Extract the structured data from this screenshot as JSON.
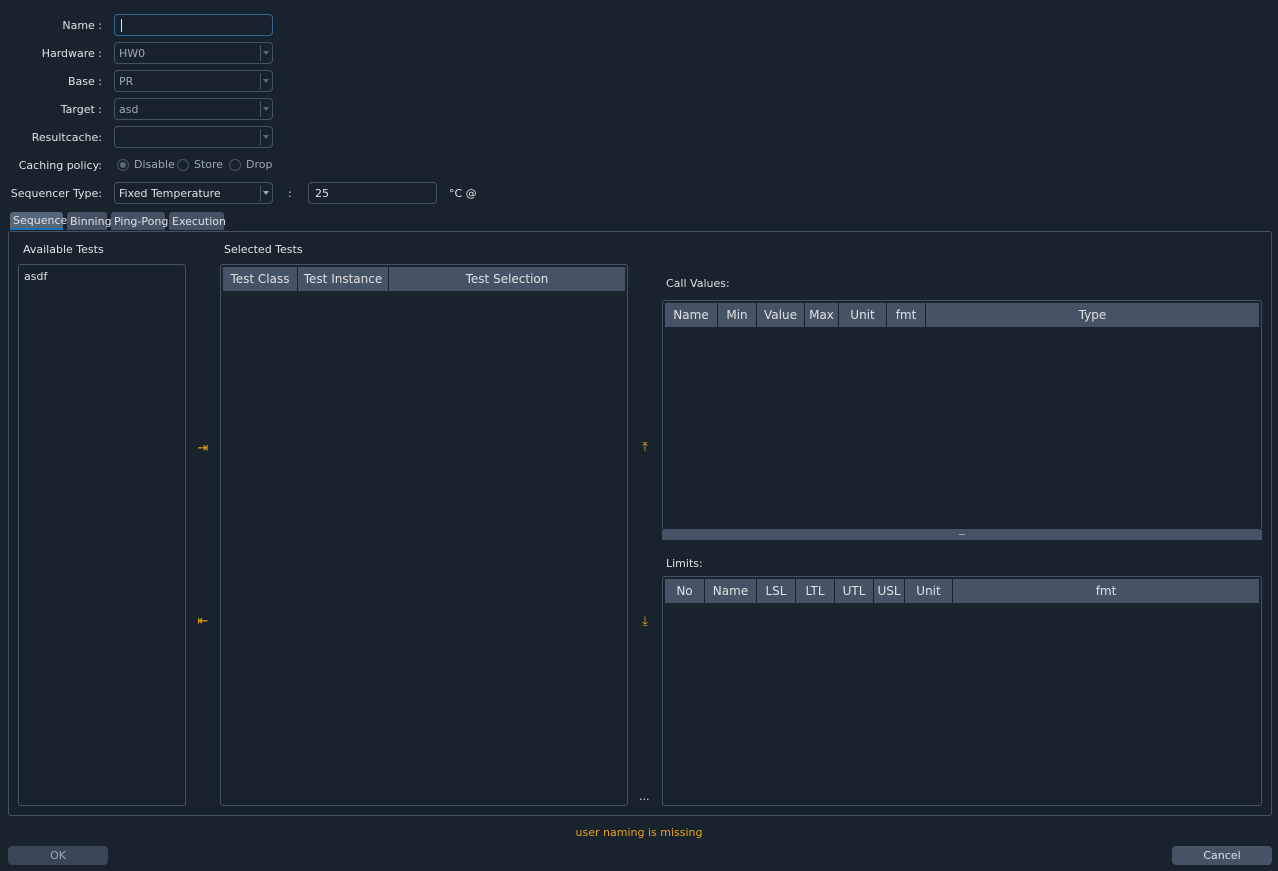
{
  "form": {
    "name_label": "Name :",
    "name_value": "",
    "hardware_label": "Hardware :",
    "hardware_value": "HW0",
    "base_label": "Base :",
    "base_value": "PR",
    "target_label": "Target :",
    "target_value": "asd",
    "resultcache_label": "Resultcache:",
    "resultcache_value": "",
    "caching_label": "Caching policy:",
    "caching_options": [
      "Disable",
      "Store",
      "Drop"
    ],
    "caching_selected": "Disable",
    "sequencer_label": "Sequencer Type:",
    "sequencer_value": "Fixed Temperature",
    "sequencer_colon": ":",
    "temperature_value": "25",
    "temperature_unit": "°C @"
  },
  "tabs": [
    "Sequence",
    "Binning",
    "Ping-Pong",
    "Execution"
  ],
  "active_tab": "Sequence",
  "available_tests": {
    "title": "Available Tests",
    "items": [
      "asdf"
    ]
  },
  "selected_tests": {
    "title": "Selected Tests",
    "columns": [
      "Test Class",
      "Test Instance",
      "Test Selection"
    ]
  },
  "call_values": {
    "title": "Call Values:",
    "columns": [
      "Name",
      "Min",
      "Value",
      "Max",
      "Unit",
      "fmt",
      "Type"
    ]
  },
  "limits": {
    "title": "Limits:",
    "columns": [
      "No",
      "Name",
      "LSL",
      "LTL",
      "UTL",
      "USL",
      "Unit",
      "fmt"
    ]
  },
  "more_label": "...",
  "status_message": "user naming is missing",
  "buttons": {
    "ok": "OK",
    "cancel": "Cancel"
  },
  "colors": {
    "background": "#19232d",
    "accent": "#e8a21b",
    "header": "#455364"
  }
}
